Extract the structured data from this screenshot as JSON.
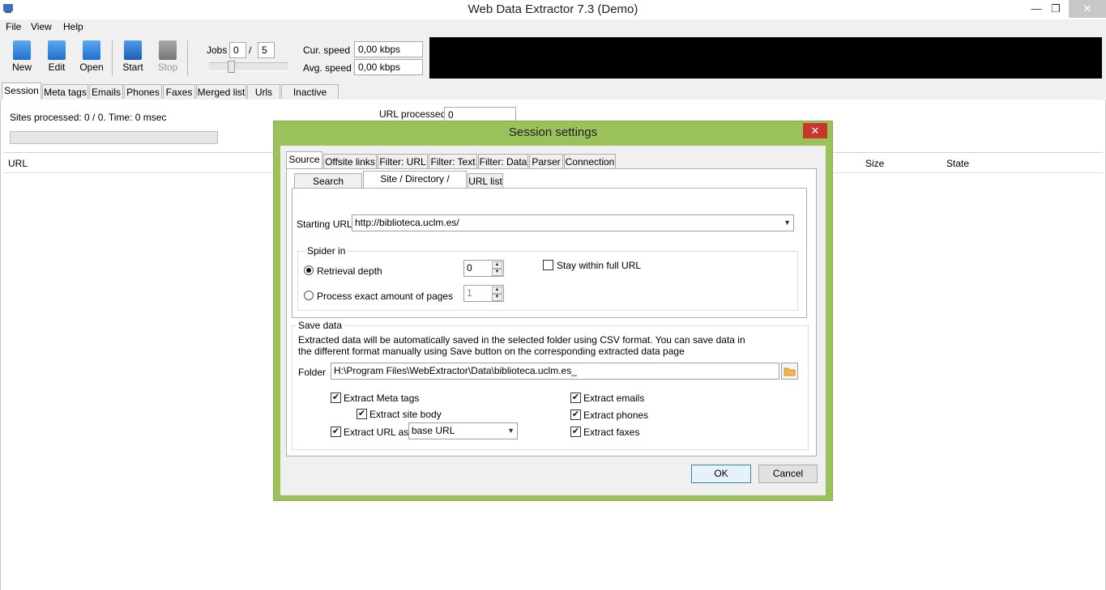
{
  "window": {
    "title": "Web Data Extractor 7.3 (Demo)",
    "minimize": "—",
    "restore": "❐",
    "close": "✕"
  },
  "menu": [
    "File",
    "View",
    "Help"
  ],
  "toolbar": {
    "new": "New",
    "edit": "Edit",
    "open": "Open",
    "start": "Start",
    "stop": "Stop",
    "jobs_label": "Jobs",
    "jobs_value": "0",
    "jobs_sep": "/",
    "jobs_max": "5",
    "cur_speed_label": "Cur. speed",
    "cur_speed_value": "0,00 kbps",
    "avg_speed_label": "Avg. speed",
    "avg_speed_value": "0,00 kbps"
  },
  "main_tabs": [
    "Session",
    "Meta tags",
    "Emails",
    "Phones",
    "Faxes",
    "Merged list",
    "Urls",
    "Inactive sites"
  ],
  "session": {
    "sites_processed": "Sites processed: 0 / 0. Time: 0 msec",
    "url_processed_label": "URL processed",
    "url_processed_value": "0",
    "columns": {
      "url": "URL",
      "size": "Size",
      "state": "State"
    }
  },
  "dialog": {
    "title": "Session settings",
    "close": "✕",
    "tabs": [
      "Source",
      "Offsite links",
      "Filter: URL",
      "Filter: Text",
      "Filter: Data",
      "Parser",
      "Connection"
    ],
    "subtabs": [
      "Search engines",
      "Site / Directory / Groups",
      "URL list"
    ],
    "starting_url_label": "Starting URL",
    "starting_url_value": "http://biblioteca.uclm.es/",
    "spider_in": "Spider in",
    "retrieval_depth_label": "Retrieval depth",
    "retrieval_depth_value": "0",
    "exact_pages_label": "Process exact amount of pages",
    "exact_pages_value": "1",
    "stay_within_label": "Stay within full URL",
    "save_data": "Save data",
    "save_desc_1": "Extracted data will be automatically saved in the selected folder using CSV format. You can save data in",
    "save_desc_2": "the different format manually using Save button on the corresponding extracted data page",
    "folder_label": "Folder",
    "folder_value": "H:\\Program Files\\WebExtractor\\Data\\biblioteca.uclm.es_",
    "extract_meta": "Extract  Meta tags",
    "extract_body": "Extract site body",
    "extract_url_as": "Extract URL as",
    "url_as_value": "base URL",
    "extract_emails": "Extract emails",
    "extract_phones": "Extract phones",
    "extract_faxes": "Extract faxes",
    "ok": "OK",
    "cancel": "Cancel"
  }
}
